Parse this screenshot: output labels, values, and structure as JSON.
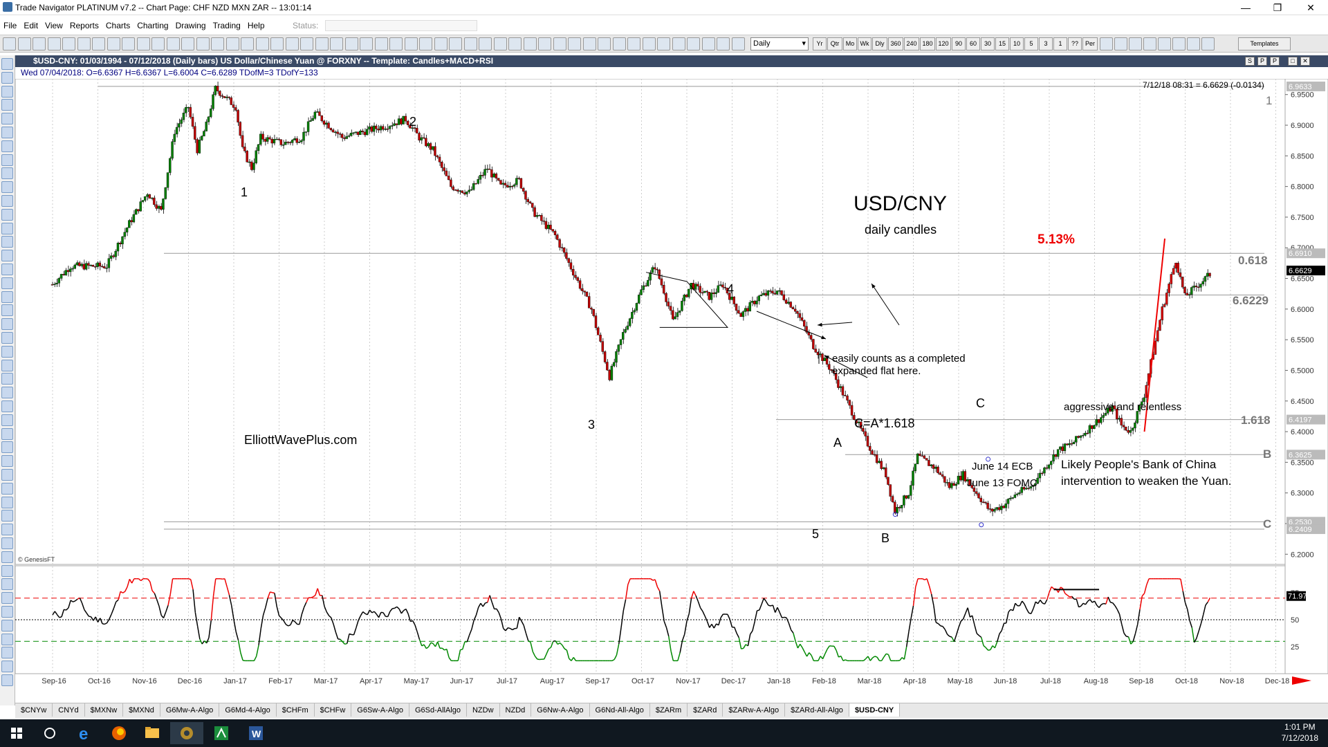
{
  "window": {
    "title": "Trade Navigator PLATINUM v7.2  --  Chart Page: CHF NZD MXN ZAR -- 13:01:14",
    "controls": [
      "—",
      "❐",
      "✕"
    ]
  },
  "menu": [
    "File",
    "Edit",
    "View",
    "Reports",
    "Charts",
    "Charting",
    "Drawing",
    "Trading",
    "Help"
  ],
  "status_label": "Status:",
  "toolbar": {
    "period": "Daily",
    "timeframes": [
      "Yr",
      "Qtr",
      "Mo",
      "Wk",
      "Dly",
      "360",
      "240",
      "180",
      "120",
      "90",
      "60",
      "30",
      "15",
      "10",
      "5",
      "3",
      "1",
      "??",
      "Per"
    ],
    "templates_label": "Templates"
  },
  "chart_header": {
    "title": "$USD-CNY:  01/03/1994 - 07/12/2018  (Daily bars)  US Dollar/Chinese Yuan @ FORXNY  --  Template: Candles+MACD+RSI",
    "buttons": [
      "S",
      "P",
      "P",
      "□",
      "✕"
    ]
  },
  "data_line": "Wed  07/04/2018:  O=6.6367  H=6.6367  L=6.6004  C=6.6289  TDofM=3  TDofY=133",
  "last_quote": "7/12/18 08:31 = 6.6629 (-0.0134)",
  "copyright": "© GenesisFT",
  "annotations": {
    "symbol": "USD/CNY",
    "subtitle": "daily candles",
    "pct": "5.13%",
    "site": "ElliottWavePlus.com",
    "flat_note_1": "easily counts as a completed",
    "flat_note_2": "expanded flat here.",
    "aggressive": "aggressive and relentless",
    "pboc_1": "Likely People's Bank of China",
    "pboc_2": "intervention to weaken the Yuan.",
    "ecb": "June 14 ECB",
    "fomc": "June 13 FOMC",
    "c_eq": "C=A*1.618",
    "waves": [
      "1",
      "2",
      "1",
      "3",
      "4",
      "5",
      "A",
      "B",
      "C"
    ],
    "level_labels": {
      "top": "1",
      "fib618": "0.618",
      "level": "6.6229",
      "fib1618": "1.618",
      "b": "B",
      "c": "C"
    }
  },
  "price_axis": {
    "ticks": [
      "6.9500",
      "6.9000",
      "6.8500",
      "6.8000",
      "6.7500",
      "6.7000",
      "6.6500",
      "6.6000",
      "6.5500",
      "6.5000",
      "6.4500",
      "6.4000",
      "6.3500",
      "6.3000",
      "6.2500",
      "6.2000"
    ],
    "tag_values": [
      "6.9633",
      "6.6910",
      "6.6629",
      "6.4197",
      "6.3625",
      "6.2530",
      "6.2409"
    ]
  },
  "rsi_axis": {
    "ticks": [
      "75",
      "50",
      "25"
    ],
    "last": "71.97"
  },
  "time_axis": [
    "Sep-16",
    "Oct-16",
    "Nov-16",
    "Dec-16",
    "Jan-17",
    "Feb-17",
    "Mar-17",
    "Apr-17",
    "May-17",
    "Jun-17",
    "Jul-17",
    "Aug-17",
    "Sep-17",
    "Oct-17",
    "Nov-17",
    "Dec-17",
    "Jan-18",
    "Feb-18",
    "Mar-18",
    "Apr-18",
    "May-18",
    "Jun-18",
    "Jul-18",
    "Aug-18",
    "Sep-18",
    "Oct-18",
    "Nov-18",
    "Dec-18"
  ],
  "tabs": [
    "$CNYw",
    "CNYd",
    "$MXNw",
    "$MXNd",
    "G6Mw-A-Algo",
    "G6Md-4-Algo",
    "$CHFm",
    "$CHFw",
    "G6Sw-A-Algo",
    "G6Sd-AllAlgo",
    "NZDw",
    "NZDd",
    "G6Nw-A-Algo",
    "G6Nd-All-Algo",
    "$ZARm",
    "$ZARd",
    "$ZARw-A-Algo",
    "$ZARd-All-Algo",
    "$USD-CNY"
  ],
  "taskbar": {
    "time": "1:01 PM",
    "date": "7/12/2018"
  },
  "chart_data": {
    "type": "candlestick",
    "title": "USD/CNY",
    "subtitle": "daily candles",
    "ylim": [
      6.18,
      6.97
    ],
    "x_months": [
      "Sep-16",
      "Oct-16",
      "Nov-16",
      "Dec-16",
      "Jan-17",
      "Feb-17",
      "Mar-17",
      "Apr-17",
      "May-17",
      "Jun-17",
      "Jul-17",
      "Aug-17",
      "Sep-17",
      "Oct-17",
      "Nov-17",
      "Dec-17",
      "Jan-18",
      "Feb-18",
      "Mar-18",
      "Apr-18",
      "May-18",
      "Jun-18",
      "Jul-18",
      "Aug-18",
      "Sep-18",
      "Oct-18",
      "Nov-18",
      "Dec-18"
    ],
    "price_path": [
      [
        0,
        6.64
      ],
      [
        0.4,
        6.67
      ],
      [
        1.2,
        6.67
      ],
      [
        1.7,
        6.74
      ],
      [
        2.1,
        6.79
      ],
      [
        2.4,
        6.76
      ],
      [
        2.7,
        6.89
      ],
      [
        3.0,
        6.93
      ],
      [
        3.2,
        6.86
      ],
      [
        3.4,
        6.9
      ],
      [
        3.6,
        6.96
      ],
      [
        4.05,
        6.93
      ],
      [
        4.2,
        6.86
      ],
      [
        4.4,
        6.83
      ],
      [
        4.6,
        6.88
      ],
      [
        5.1,
        6.87
      ],
      [
        5.5,
        6.88
      ],
      [
        5.8,
        6.92
      ],
      [
        6.4,
        6.88
      ],
      [
        6.9,
        6.89
      ],
      [
        7.4,
        6.9
      ],
      [
        7.8,
        6.91
      ],
      [
        8.1,
        6.88
      ],
      [
        8.4,
        6.86
      ],
      [
        8.8,
        6.8
      ],
      [
        9.2,
        6.79
      ],
      [
        9.6,
        6.83
      ],
      [
        9.9,
        6.8
      ],
      [
        10.3,
        6.81
      ],
      [
        10.6,
        6.76
      ],
      [
        11.1,
        6.72
      ],
      [
        11.5,
        6.66
      ],
      [
        11.9,
        6.6
      ],
      [
        12.15,
        6.53
      ],
      [
        12.3,
        6.49
      ],
      [
        12.6,
        6.56
      ],
      [
        13.0,
        6.63
      ],
      [
        13.3,
        6.67
      ],
      [
        13.5,
        6.63
      ],
      [
        13.7,
        6.58
      ],
      [
        14.1,
        6.64
      ],
      [
        14.5,
        6.62
      ],
      [
        14.8,
        6.64
      ],
      [
        15.2,
        6.59
      ],
      [
        15.6,
        6.62
      ],
      [
        16.0,
        6.63
      ],
      [
        16.4,
        6.6
      ],
      [
        16.8,
        6.54
      ],
      [
        17.2,
        6.5
      ],
      [
        17.6,
        6.44
      ],
      [
        18.0,
        6.38
      ],
      [
        18.4,
        6.33
      ],
      [
        18.6,
        6.27
      ],
      [
        18.9,
        6.3
      ],
      [
        19.1,
        6.36
      ],
      [
        19.5,
        6.34
      ],
      [
        19.8,
        6.31
      ],
      [
        20.1,
        6.33
      ],
      [
        20.4,
        6.3
      ],
      [
        20.7,
        6.27
      ],
      [
        21.0,
        6.28
      ],
      [
        21.3,
        6.3
      ],
      [
        21.6,
        6.31
      ],
      [
        21.9,
        6.34
      ],
      [
        22.2,
        6.37
      ],
      [
        22.5,
        6.38
      ],
      [
        22.8,
        6.4
      ],
      [
        23.1,
        6.42
      ],
      [
        23.4,
        6.44
      ],
      [
        23.6,
        6.41
      ],
      [
        23.8,
        6.4
      ],
      [
        24.1,
        6.46
      ],
      [
        24.5,
        6.6
      ],
      [
        24.8,
        6.68
      ],
      [
        25.0,
        6.62
      ],
      [
        25.3,
        6.64
      ],
      [
        25.6,
        6.66
      ]
    ],
    "horizontal_levels": [
      {
        "label": "1",
        "value": 6.9633
      },
      {
        "label": "0.618",
        "value": 6.691
      },
      {
        "label": "6.6229",
        "value": 6.6229
      },
      {
        "label": "1.618",
        "value": 6.4197
      },
      {
        "label": "B",
        "value": 6.3625
      },
      {
        "label": "C",
        "value": 6.253
      },
      {
        "value": 6.2409
      }
    ],
    "rsi": {
      "levels": [
        70,
        50,
        30
      ],
      "last": 71.97
    }
  }
}
